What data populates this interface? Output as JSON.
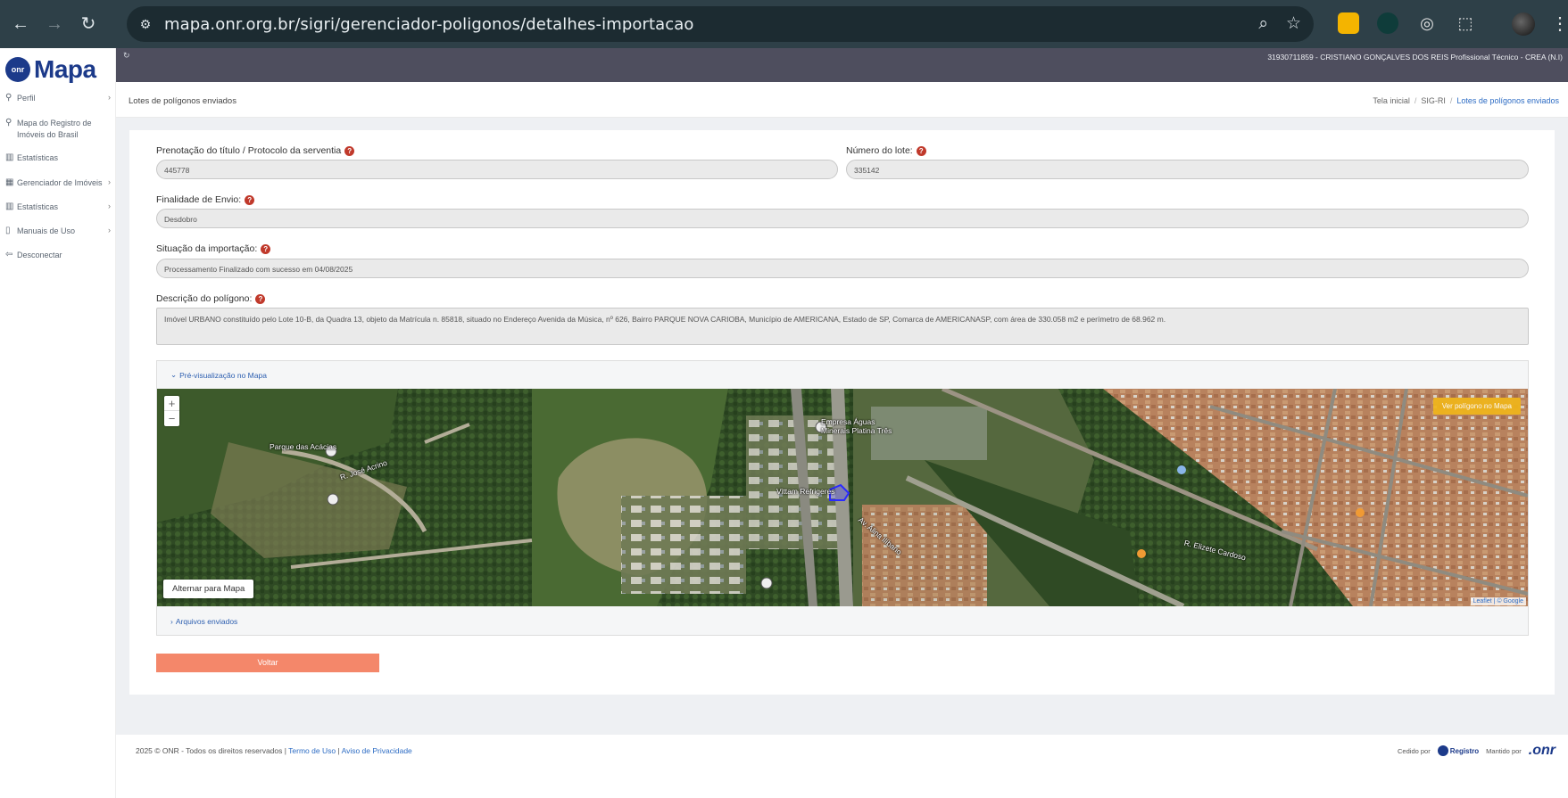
{
  "browser": {
    "url": "mapa.onr.org.br/sigri/gerenciador-poligonos/detalhes-importacao"
  },
  "sidebar": {
    "logo": "Mapa",
    "items": [
      {
        "label": "Perfil",
        "icon": "user-icon"
      },
      {
        "label": "Mapa do Registro de Imóveis do Brasil",
        "icon": "map-user-icon"
      },
      {
        "label": "Estatísticas",
        "icon": "bar-chart-icon"
      },
      {
        "label": "Gerenciador de Imóveis",
        "icon": "grid-icon"
      },
      {
        "label": "Estatísticas",
        "icon": "bar-chart-icon"
      },
      {
        "label": "Manuais de Uso",
        "icon": "document-icon"
      },
      {
        "label": "Desconectar",
        "icon": "logout-icon"
      }
    ]
  },
  "header": {
    "user": "31930711859 - CRISTIANO GONÇALVES DOS REIS Profissional Técnico - CREA (N.I)"
  },
  "breadcrumb": {
    "page_title": "Lotes de polígonos enviados",
    "items": [
      "Tela inicial",
      "SIG-RI",
      "Lotes de polígonos enviados"
    ]
  },
  "form": {
    "prenotacao_label": "Prenotação do título / Protocolo da serventia",
    "prenotacao_value": "445778",
    "lote_label": "Número do lote:",
    "lote_value": "335142",
    "finalidade_label": "Finalidade de Envio:",
    "finalidade_value": "Desdobro",
    "situacao_label": "Situação da importação:",
    "situacao_value": "Processamento Finalizado com sucesso em 04/08/2025",
    "descricao_label": "Descrição do polígono:",
    "descricao_value": "Imóvel URBANO constituído pelo Lote 10-B, da Quadra 13, objeto da Matrícula n. 85818, situado no Endereço Avenida da Música, nº 626, Bairro PARQUE NOVA CARIOBA, Município de AMERICANA, Estado de SP, Comarca de AMERICANASP, com área de 330.058 m2 e perímetro de 68.962 m."
  },
  "preview": {
    "toggle_label": "Pré-visualização no Mapa",
    "switch_label": "Alternar para Mapa",
    "view_label": "Ver polígono no Mapa",
    "attribution": "Leaflet | © Google",
    "zoom_in": "+",
    "zoom_out": "−",
    "map_labels": [
      "Parque das Acácias",
      "Empresa Águas Minerais Platina Três",
      "Vittam Refrigeres",
      "R. José Acrino",
      "Av. Alina Ilíbano",
      "R. Elizete Cardoso"
    ]
  },
  "files": {
    "toggle_label": "Arquivos enviados"
  },
  "actions": {
    "back_label": "Voltar"
  },
  "footer": {
    "copyright": "2025 © ONR - Todos os direitos reservados |",
    "terms": "Termo de Uso",
    "privacy": "Aviso de Privacidade",
    "ceded_by": "Cedido por",
    "registro": "Registro",
    "maintained_by": "Mantido por",
    "onr": ".onr"
  },
  "colors": {
    "header": "#4e4e5e",
    "brand": "#1c3a8a",
    "back_button": "#f4876a",
    "view_button": "#f0b51a",
    "help": "#c0392b"
  }
}
